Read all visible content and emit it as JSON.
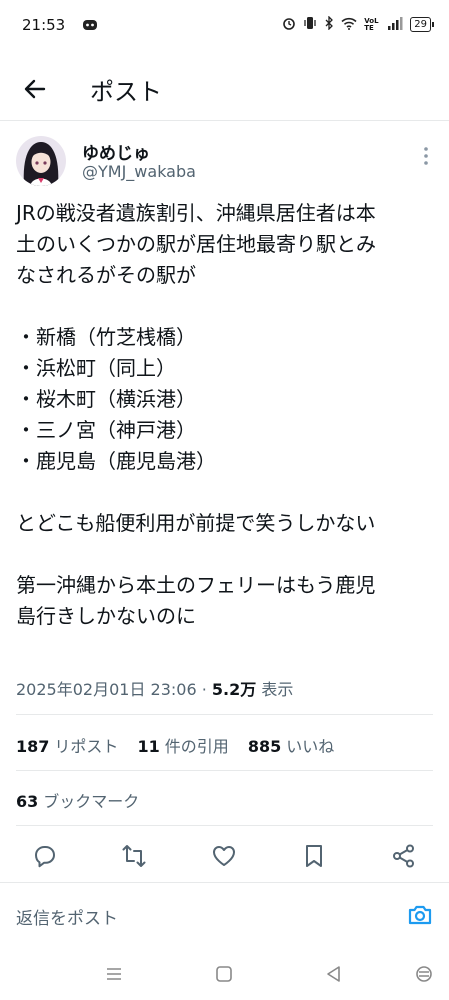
{
  "status": {
    "time": "21:53",
    "network_label": "VoLTE",
    "battery": "29"
  },
  "header": {
    "title": "ポスト"
  },
  "author": {
    "name": "ゆめじゅ",
    "handle": "@YMJ_wakaba"
  },
  "tweet": {
    "lines": [
      "JRの戦没者遺族割引、沖縄県居住者は本",
      "土のいくつかの駅が居住地最寄り駅とみ",
      "なされるがその駅が"
    ],
    "items": [
      "・新橋（竹芝桟橋）",
      "・浜松町（同上）",
      "・桜木町（横浜港）",
      "・三ノ宮（神戸港）",
      "・鹿児島（鹿児島港）"
    ],
    "para2": "とどこも船便利用が前提で笑うしかない",
    "para3_line1": "第一沖縄から本土のフェリーはもう鹿児",
    "para3_line2": "島行きしかないのに"
  },
  "meta": {
    "timestamp": "2025年02月01日 23:06 · ",
    "views": "5.2万",
    "views_label": " 表示"
  },
  "stats": {
    "reposts_count": "187",
    "reposts_label": "リポスト",
    "quotes_count": "11",
    "quotes_label": "件の引用",
    "likes_count": "885",
    "likes_label": "いいね",
    "bookmarks_count": "63",
    "bookmarks_label": "ブックマーク"
  },
  "reply": {
    "placeholder": "返信をポスト"
  },
  "colors": {
    "text": "#0f1419",
    "secondary": "#536471",
    "divider": "#e7e9ea",
    "accent": "#1d9bf0"
  },
  "icons": [
    "back-arrow-icon",
    "more-vertical-icon",
    "reply-icon",
    "repost-icon",
    "like-icon",
    "bookmark-icon",
    "share-icon",
    "camera-icon"
  ]
}
